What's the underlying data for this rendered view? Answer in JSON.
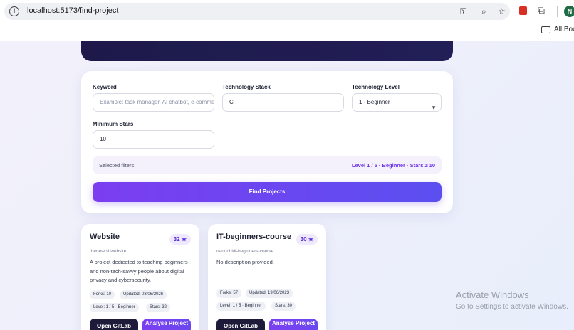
{
  "browser": {
    "url": "localhost:5173/find-project",
    "avatar_letter": "N",
    "bookmarks_label": "All Boo"
  },
  "filters": {
    "keyword": {
      "label": "Keyword",
      "placeholder": "Example: task manager, AI chatbot, e-commerce"
    },
    "stack": {
      "label": "Technology Stack",
      "value": "C"
    },
    "level": {
      "label": "Technology Level",
      "value": "1 - Beginner"
    },
    "stars": {
      "label": "Minimum Stars",
      "value": "10"
    },
    "selected_label": "Selected filters:",
    "selected_value": "Level 1 / 5 · Beginner · Stars ≥ 10",
    "find_button": "Find Projects"
  },
  "projects": [
    {
      "title": "Website",
      "stars": "32 ★",
      "slug": "thenewoil/website",
      "description": "A project dedicated to teaching beginners and non-tech-savvy people about digital privacy and cybersecurity.",
      "forks": "Forks: 10",
      "updated": "Updated: 08/06/2026",
      "level": "Level: 1 / 5 · Beginner",
      "stars_chip": "Stars: 32",
      "gitlab_button": "Open GitLab",
      "analyse_button": "Analyse Project"
    },
    {
      "title": "IT-beginners-course",
      "stars": "30 ★",
      "slug": "nanuchi/it-beginners-course",
      "description": "No description provided.",
      "forks": "Forks: 57",
      "updated": "Updated: 19/06/2023",
      "level": "Level: 1 / 5 · Beginner",
      "stars_chip": "Stars: 30",
      "gitlab_button": "Open GitLab",
      "analyse_button": "Analyse Project"
    }
  ],
  "watermark": {
    "title": "Activate Windows",
    "subtitle": "Go to Settings to activate Windows."
  }
}
